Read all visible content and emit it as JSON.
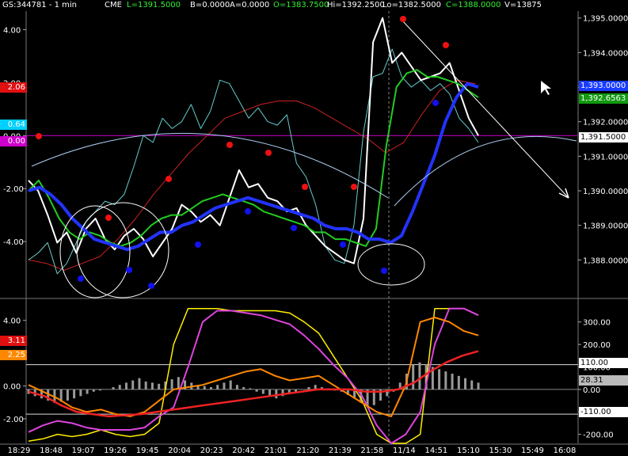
{
  "header": {
    "symbol": "GS:344781 - 1 min",
    "exchange": "CME",
    "last": "L=1391.5000",
    "bid": "B=0.0000",
    "ask": "A=0.0000",
    "open": "O=1383.7500",
    "high": "Hi=1392.2500",
    "low": "Lo=1382.5000",
    "close": "C=1388.0000",
    "volume": "V=13875"
  },
  "colors": {
    "background": "#000000",
    "price": "#ffffff",
    "cyan_series": "#66cccc",
    "ma_fast": "#22cc22",
    "ma_slow": "#2233ff",
    "ma_long": "#cc2222",
    "dots_up": "#ee1111",
    "dots_down": "#1111ee",
    "magenta": "#dd44dd",
    "yellow": "#ffee00",
    "orange": "#ff8800",
    "red_osc": "#ee2222"
  },
  "chart_data": [
    {
      "type": "line",
      "panel": "price",
      "x_ticks": [
        "18:29",
        "18:48",
        "19:07",
        "19:26",
        "19:45",
        "20:04",
        "20:23",
        "20:42",
        "21:01",
        "21:20",
        "21:39",
        "21:58",
        "11/14",
        "14:51",
        "15:10",
        "15:30",
        "15:49",
        "16:08"
      ],
      "right_axis": {
        "ticks": [
          "1,395.0000",
          "1,394.0000",
          "1,393.0000",
          "1,392.0000",
          "1,391.0000",
          "1,390.0000",
          "1,389.0000",
          "1,388.0000"
        ],
        "ylim": [
          1387.0,
          1395.2
        ]
      },
      "left_axis": {
        "ticks": [
          "4.00",
          "2.00",
          "0.00",
          "-2.00",
          "-4.00"
        ],
        "ylim": [
          -6.0,
          4.7
        ]
      },
      "tags_left": [
        {
          "text": "2.06",
          "color": "#e01010"
        },
        {
          "text": "0.64",
          "color": "#00d0ff"
        },
        {
          "text": "0.00",
          "color": "#cc00cc"
        }
      ],
      "tags_right": [
        {
          "text": "1,393.0000",
          "color": "#1a3cff"
        },
        {
          "text": "1,392.6563",
          "color": "#119911"
        },
        {
          "text": "1,391.5000",
          "color": "#ffffff"
        }
      ],
      "series": [
        {
          "color": "#ffffff",
          "values": [
            1390.3,
            1390.0,
            1389.3,
            1388.5,
            1388.8,
            1388.2,
            1388.9,
            1389.2,
            1388.6,
            1388.3,
            1388.7,
            1388.9,
            1388.6,
            1388.1,
            1388.5,
            1388.9,
            1389.6,
            1389.4,
            1389.1,
            1389.3,
            1389.0,
            1389.8,
            1390.6,
            1390.1,
            1390.2,
            1389.8,
            1389.7,
            1389.4,
            1389.5,
            1389.0,
            1388.7,
            1388.4,
            1388.2,
            1388.0,
            1387.9,
            1389.2,
            1394.3,
            1395.0,
            1393.7,
            1394.0,
            1393.6,
            1393.2,
            1393.3,
            1393.4,
            1393.7,
            1392.9,
            1392.1,
            1391.6
          ]
        },
        {
          "color": "#66cccc",
          "values": [
            1388.0,
            1388.2,
            1388.5,
            1387.6,
            1387.9,
            1388.5,
            1389.1,
            1389.4,
            1389.7,
            1389.6,
            1389.9,
            1390.7,
            1391.6,
            1391.4,
            1392.1,
            1391.8,
            1392.0,
            1392.5,
            1391.8,
            1392.3,
            1393.2,
            1393.1,
            1392.6,
            1392.1,
            1392.4,
            1392.0,
            1391.9,
            1392.2,
            1390.8,
            1390.4,
            1389.6,
            1388.4,
            1388.0,
            1387.9,
            1389.0,
            1391.7,
            1393.3,
            1393.4,
            1394.1,
            1393.3,
            1393.0,
            1393.2,
            1392.9,
            1393.1,
            1392.8,
            1392.1,
            1391.8,
            1391.4
          ]
        },
        {
          "color": "#22cc22",
          "values": [
            1390.0,
            1390.3,
            1389.8,
            1389.2,
            1388.8,
            1388.6,
            1388.8,
            1388.7,
            1388.5,
            1388.4,
            1388.5,
            1388.7,
            1389.0,
            1389.2,
            1389.3,
            1389.3,
            1389.5,
            1389.7,
            1389.8,
            1389.9,
            1389.8,
            1389.7,
            1389.6,
            1389.4,
            1389.3,
            1389.2,
            1389.1,
            1389.0,
            1388.8,
            1388.8,
            1388.6,
            1388.6,
            1388.5,
            1388.4,
            1388.9,
            1391.3,
            1393.0,
            1393.4,
            1393.5,
            1393.3,
            1393.3,
            1393.2,
            1393.1,
            1392.9,
            1392.7
          ]
        },
        {
          "color": "#2233ff",
          "values": [
            1390.0,
            1390.1,
            1389.9,
            1389.6,
            1389.2,
            1388.9,
            1388.6,
            1388.5,
            1388.4,
            1388.3,
            1388.4,
            1388.6,
            1388.8,
            1388.8,
            1389.0,
            1389.1,
            1389.3,
            1389.5,
            1389.6,
            1389.7,
            1389.8,
            1389.7,
            1389.6,
            1389.5,
            1389.4,
            1389.3,
            1389.2,
            1389.0,
            1388.9,
            1388.9,
            1388.8,
            1388.6,
            1388.6,
            1388.5,
            1388.7,
            1389.4,
            1390.2,
            1391.0,
            1392.0,
            1392.7,
            1393.1,
            1393.0
          ]
        },
        {
          "color": "#cc2222",
          "values": [
            1388.0,
            1387.9,
            1387.7,
            1387.9,
            1388.1,
            1388.6,
            1389.2,
            1389.9,
            1390.5,
            1391.1,
            1391.6,
            1392.1,
            1392.3,
            1392.5,
            1392.6,
            1392.6,
            1392.4,
            1392.1,
            1391.8,
            1391.5,
            1391.1,
            1391.4,
            1392.2,
            1392.9,
            1393.2,
            1393.1
          ]
        }
      ]
    },
    {
      "type": "line",
      "panel": "oscillator",
      "x_ticks": [
        "18:29",
        "18:48",
        "19:07",
        "19:26",
        "19:45",
        "20:04",
        "20:23",
        "20:42",
        "21:01",
        "21:20",
        "21:39",
        "21:58",
        "11/14",
        "14:51",
        "15:10",
        "15:30",
        "15:49",
        "16:08"
      ],
      "left_axis": {
        "ticks": [
          "4.00",
          "2.00",
          "0.00",
          "-2.00"
        ],
        "ylim": [
          -3.5,
          5.0
        ]
      },
      "right_axis": {
        "ticks": [
          "300.00",
          "200.00",
          "100.00",
          "0.00",
          "-100.00",
          "-200.00"
        ],
        "ylim": [
          -240,
          380
        ]
      },
      "tags_left": [
        {
          "text": "3.11",
          "color": "#e01010"
        },
        {
          "text": "2.25",
          "color": "#ff8800"
        }
      ],
      "tags_right": [
        {
          "text": "110.00",
          "color": "#ffffff"
        },
        {
          "text": "28.31",
          "color": "#bbbbbb"
        },
        {
          "text": "-110.00",
          "color": "#ffffff"
        }
      ],
      "series": [
        {
          "color": "#ffee00",
          "values": [
            -230,
            -220,
            -200,
            -210,
            -200,
            -180,
            -200,
            -210,
            -200,
            -150,
            200,
            360,
            360,
            360,
            350,
            350,
            350,
            350,
            340,
            300,
            250,
            150,
            50,
            -50,
            -200,
            -240,
            -240,
            -200,
            360,
            360,
            360,
            330
          ]
        },
        {
          "color": "#dd44dd",
          "values": [
            -190,
            -160,
            -140,
            -150,
            -170,
            -180,
            -180,
            -180,
            -170,
            -120,
            -80,
            100,
            300,
            350,
            350,
            340,
            330,
            310,
            290,
            240,
            180,
            110,
            50,
            -30,
            -160,
            -240,
            -200,
            -100,
            200,
            360,
            360,
            330
          ]
        },
        {
          "color": "#ff8800",
          "values": [
            20,
            -10,
            -40,
            -80,
            -100,
            -90,
            -110,
            -120,
            -100,
            -50,
            0,
            10,
            20,
            40,
            60,
            80,
            90,
            60,
            40,
            50,
            60,
            20,
            -20,
            -60,
            -100,
            -120,
            20,
            300,
            320,
            300,
            260,
            240
          ]
        },
        {
          "color": "#ee2222",
          "values": [
            -10,
            -30,
            -70,
            -100,
            -110,
            -120,
            -115,
            -110,
            -100,
            -90,
            -80,
            -70,
            -60,
            -50,
            -40,
            -30,
            -20,
            -10,
            0,
            0,
            0,
            -10,
            -10,
            0,
            30,
            80,
            120,
            150,
            170
          ]
        }
      ]
    }
  ]
}
